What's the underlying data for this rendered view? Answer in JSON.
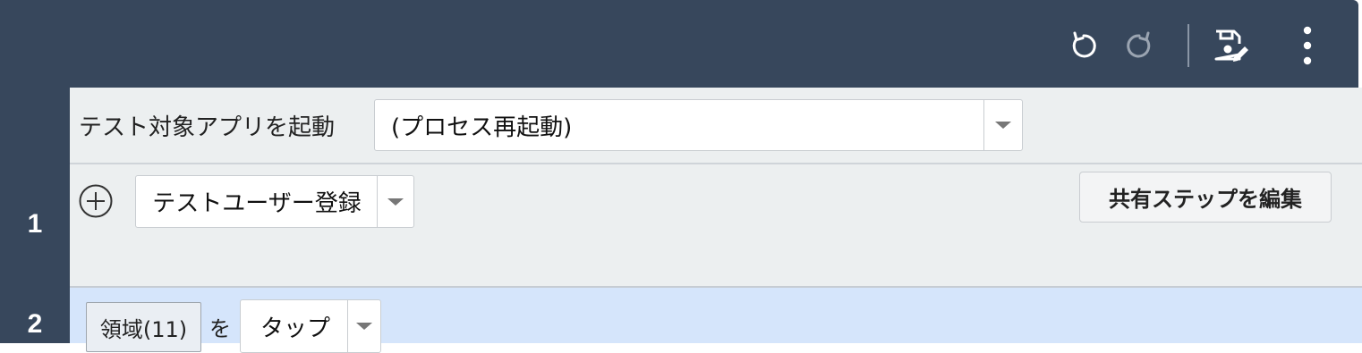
{
  "toolbar": {
    "undo_icon": "undo-icon",
    "redo_icon": "redo-icon",
    "save_icon": "save-edit-icon",
    "more_icon": "more-vertical-icon"
  },
  "rows": [
    {
      "number": "",
      "label": "テスト対象アプリを起動",
      "select_value": "(プロセス再起動)"
    },
    {
      "number": "1",
      "add_icon": "plus-circle-icon",
      "select_value": "テストユーザー登録",
      "edit_button": "共有ステップを編集"
    },
    {
      "number": "2",
      "chip": "領域(11)",
      "particle": "を",
      "select_value": "タップ"
    }
  ],
  "colors": {
    "header": "#37475c",
    "row_bg": "#eceff0",
    "selected_row_bg": "#d5e5fb"
  }
}
